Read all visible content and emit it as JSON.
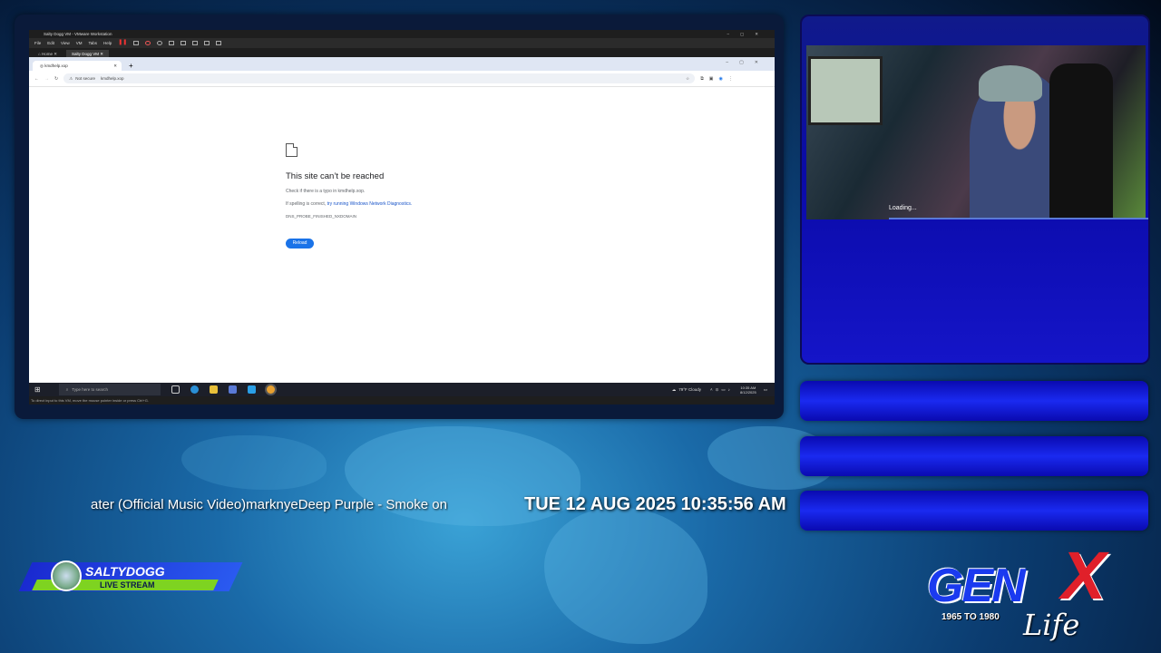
{
  "vm": {
    "window_title": "Salty Dogg VM - VMware Workstation",
    "menu": [
      "File",
      "Edit",
      "View",
      "VM",
      "Tabs",
      "Help"
    ],
    "tabs": [
      "Home",
      "Salty Dogg VM"
    ],
    "status_hint": "To direct input to this VM, move the mouse pointer inside or press Ctrl+G."
  },
  "browser": {
    "tab_title": "kmdhelp.xop",
    "address_prefix": "Not secure",
    "address": "kmdhelp.xop",
    "error": {
      "title": "This site can’t be reached",
      "line1": "Check if there is a typo in kmdhelp.xop.",
      "line2_prefix": "If spelling is correct, ",
      "line2_link": "try running Windows Network Diagnostics.",
      "code": "DNS_PROBE_FINISHED_NXDOMAIN",
      "reload": "Reload"
    }
  },
  "taskbar": {
    "search_placeholder": "Type here to search",
    "weather": "79°F  Cloudy",
    "time": "10:35 AM",
    "date": "8/12/2025"
  },
  "camera": {
    "loading": "Loading..."
  },
  "overlay": {
    "ticker": "ater (Official Music Video)marknyeDeep Purple - Smoke on the Water",
    "clock": "TUE 12 AUG 2025 10:35:56 AM",
    "badge_name": "SALTYDOGG",
    "badge_sub": "LIVE STREAM",
    "logo_main": "GEN",
    "logo_x": "X",
    "logo_years": "1965 TO 1980",
    "logo_life": "Life"
  },
  "colors": {
    "accent_blue": "#1a2af0",
    "badge_green": "#7ed321",
    "logo_red": "#e0202a"
  }
}
